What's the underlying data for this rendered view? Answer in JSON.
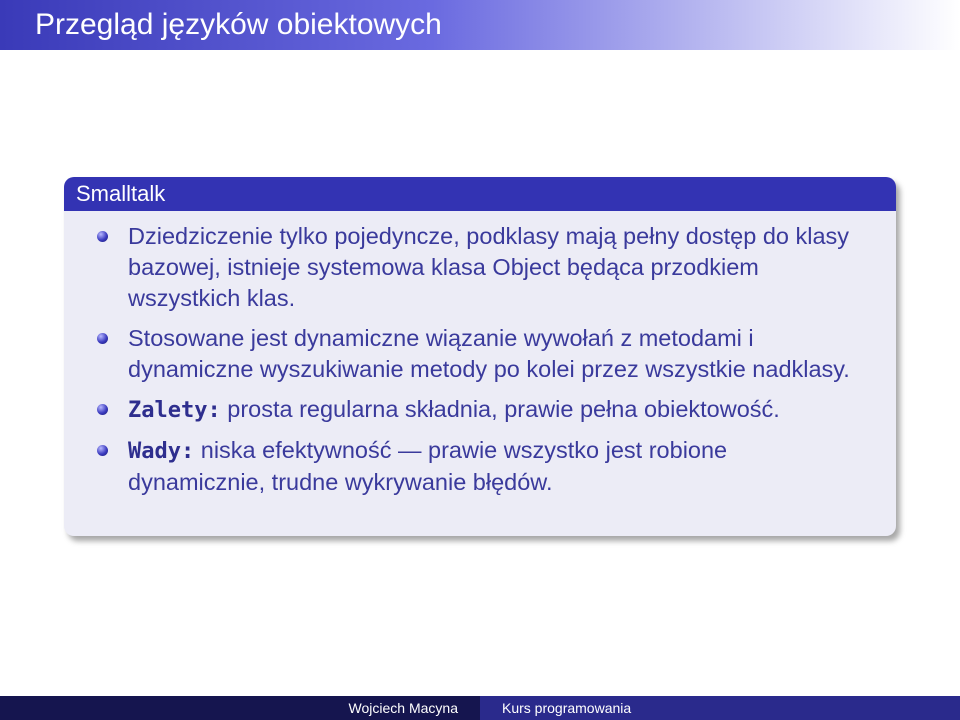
{
  "slide": {
    "title": "Przegląd języków obiektowych"
  },
  "block": {
    "title": "Smalltalk",
    "items": [
      {
        "lead": "",
        "text": "Dziedziczenie tylko pojedyncze, podklasy mają pełny dostęp do klasy bazowej, istnieje systemowa klasa Object będąca przodkiem wszystkich klas."
      },
      {
        "lead": "",
        "text": "Stosowane jest dynamiczne wiązanie wywołań z metodami i dynamiczne wyszukiwanie metody po kolei przez wszystkie nadklasy."
      },
      {
        "lead": "Zalety:",
        "text": "prosta regularna składnia, prawie pełna obiektowość."
      },
      {
        "lead": "Wady:",
        "text": "niska efektywność — prawie wszystko jest robione dynamicznie, trudne wykrywanie błędów."
      }
    ]
  },
  "footer": {
    "author": "Wojciech Macyna",
    "course": "Kurs programowania"
  }
}
